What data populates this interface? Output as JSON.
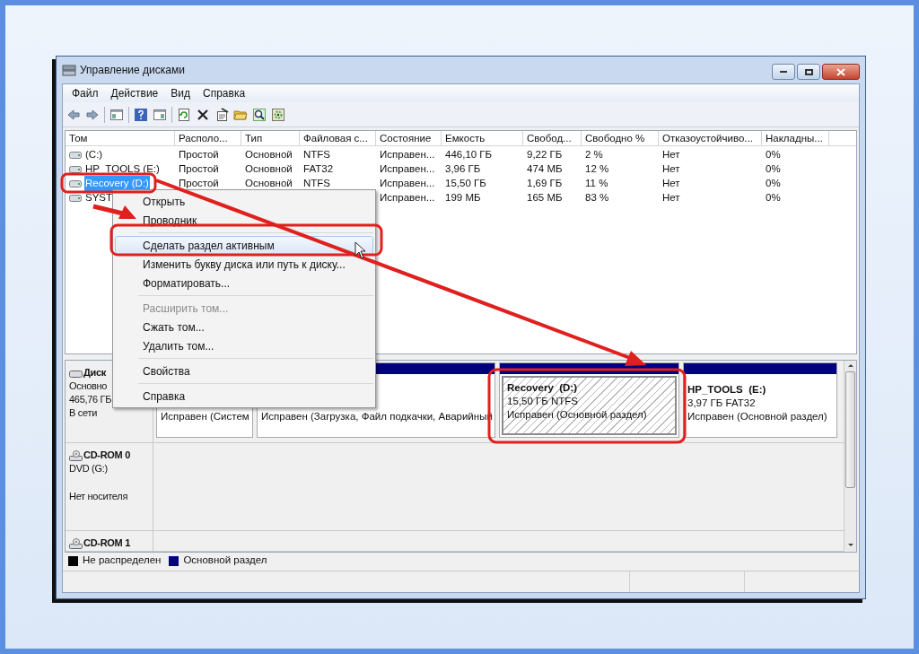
{
  "window": {
    "title": "Управление дисками"
  },
  "menu": [
    "Файл",
    "Действие",
    "Вид",
    "Справка"
  ],
  "volumes": {
    "columns": [
      "Том",
      "Располо...",
      "Тип",
      "Файловая с...",
      "Состояние",
      "Емкость",
      "Свобод...",
      "Свободно %",
      "Отказоустойчиво...",
      "Накладны..."
    ],
    "rows": [
      {
        "selected": false,
        "cells": [
          "(C:)",
          "Простой",
          "Основной",
          "NTFS",
          "Исправен...",
          "446,10 ГБ",
          "9,22 ГБ",
          "2 %",
          "Нет",
          "0%"
        ]
      },
      {
        "selected": false,
        "cells": [
          "HP_TOOLS (E:)",
          "Простой",
          "Основной",
          "FAT32",
          "Исправен...",
          "3,96 ГБ",
          "474 МБ",
          "12 %",
          "Нет",
          "0%"
        ]
      },
      {
        "selected": true,
        "cells": [
          "Recovery (D:)",
          "Простой",
          "Основной",
          "NTFS",
          "Исправен...",
          "15,50 ГБ",
          "1,69 ГБ",
          "11 %",
          "Нет",
          "0%"
        ]
      },
      {
        "selected": false,
        "cells": [
          "SYST",
          null,
          null,
          null,
          "Исправен...",
          "199 МБ",
          "165 МБ",
          "83 %",
          "Нет",
          "0%"
        ]
      }
    ]
  },
  "context_menu": [
    {
      "kind": "item",
      "label": "Открыть",
      "disabled": false,
      "selected": false
    },
    {
      "kind": "item",
      "label": "Проводник",
      "disabled": false,
      "selected": false
    },
    {
      "kind": "separator"
    },
    {
      "kind": "item",
      "label": "Сделать раздел активным",
      "disabled": false,
      "selected": true
    },
    {
      "kind": "item",
      "label": "Изменить букву диска или путь к диску...",
      "disabled": false,
      "selected": false
    },
    {
      "kind": "item",
      "label": "Форматировать...",
      "disabled": false,
      "selected": false
    },
    {
      "kind": "separator"
    },
    {
      "kind": "item",
      "label": "Расширить том...",
      "disabled": true,
      "selected": false
    },
    {
      "kind": "item",
      "label": "Сжать том...",
      "disabled": false,
      "selected": false
    },
    {
      "kind": "item",
      "label": "Удалить том...",
      "disabled": false,
      "selected": false
    },
    {
      "kind": "separator"
    },
    {
      "kind": "item",
      "label": "Свойства",
      "disabled": false,
      "selected": false
    },
    {
      "kind": "separator"
    },
    {
      "kind": "item",
      "label": "Справка",
      "disabled": false,
      "selected": false
    }
  ],
  "disks": [
    {
      "kind": "disk",
      "name": "Диск",
      "lines": [
        "Основно",
        "465,76 ГБ",
        "В сети"
      ],
      "partitions": [
        {
          "status": "Исправен (Систем",
          "selected": false
        },
        {
          "status": "Исправен (Загрузка, Файл подкачки, Аварийный",
          "selected": false
        },
        {
          "name": "Recovery  (D:)",
          "detail": "15,50 ГБ NTFS",
          "status": "Исправен (Основной раздел)",
          "selected": true
        },
        {
          "name": "HP_TOOLS  (E:)",
          "detail": "3,97 ГБ FAT32",
          "status": "Исправен (Основной раздел)",
          "selected": false
        }
      ]
    },
    {
      "kind": "cdrom",
      "name": "CD-ROM 0",
      "lines": [
        "DVD (G:)",
        "Нет носителя"
      ]
    },
    {
      "kind": "cdrom",
      "name": "CD-ROM 1"
    }
  ],
  "legend": [
    {
      "label": "Не распределен",
      "color": "#000000"
    },
    {
      "label": "Основной раздел",
      "color": "#000080"
    }
  ]
}
